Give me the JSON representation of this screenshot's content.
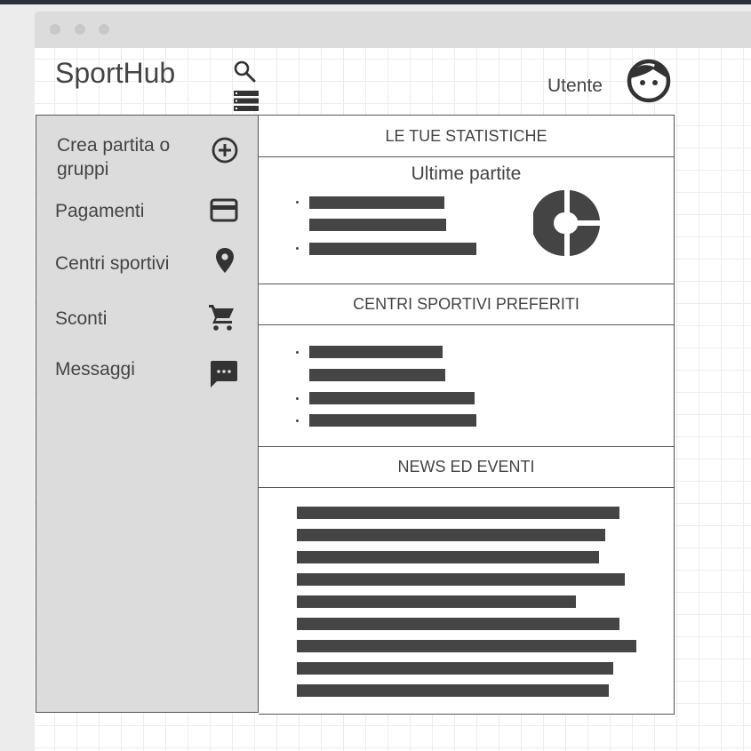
{
  "app": {
    "title": "SportHub",
    "user_label": "Utente"
  },
  "icons": {
    "search": "search-icon",
    "menu": "list-menu-icon",
    "avatar": "user-avatar-icon",
    "create": "plus-circle-icon",
    "payments": "credit-card-icon",
    "centers": "location-pin-icon",
    "discounts": "shopping-cart-icon",
    "messages": "chat-bubble-icon",
    "chart": "pie-chart-icon"
  },
  "sidebar": {
    "items": [
      {
        "label": "Crea partita o gruppi"
      },
      {
        "label": "Pagamenti"
      },
      {
        "label": "Centri sportivi"
      },
      {
        "label": "Sconti"
      },
      {
        "label": "Messaggi"
      }
    ]
  },
  "main": {
    "stats_header": "LE TUE STATISTICHE",
    "stats_subtitle": "Ultime partite",
    "favorites_header": "CENTRI SPORTIVI PREFERITI",
    "news_header": "NEWS ED EVENTI"
  },
  "colors": {
    "sidebar_bg": "#dcdcdc",
    "placeholder_bar": "#454545",
    "text": "#444444"
  }
}
